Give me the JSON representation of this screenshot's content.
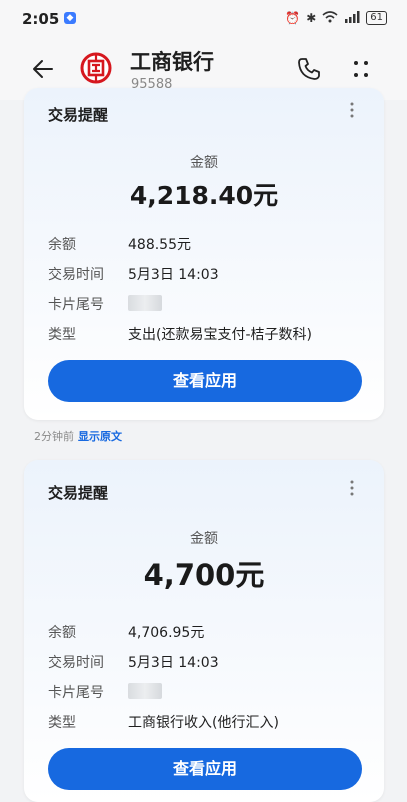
{
  "status_bar": {
    "time": "2:05",
    "battery": "61"
  },
  "header": {
    "bank_name": "工商银行",
    "bank_number": "95588"
  },
  "messages": [
    {
      "title": "交易提醒",
      "amount_label": "金额",
      "amount": "4,218.40元",
      "rows": [
        {
          "label": "余额",
          "value": "488.55元"
        },
        {
          "label": "交易时间",
          "value": "5月3日 14:03"
        },
        {
          "label": "卡片尾号",
          "value": ""
        },
        {
          "label": "类型",
          "value": "支出(还款易宝支付-桔子数科)"
        }
      ],
      "action_label": "查看应用",
      "timestamp": "2分钟前",
      "show_original": "显示原文"
    },
    {
      "title": "交易提醒",
      "amount_label": "金额",
      "amount": "4,700元",
      "rows": [
        {
          "label": "余额",
          "value": "4,706.95元"
        },
        {
          "label": "交易时间",
          "value": "5月3日 14:03"
        },
        {
          "label": "卡片尾号",
          "value": ""
        },
        {
          "label": "类型",
          "value": "工商银行收入(他行汇入)"
        }
      ],
      "action_label": "查看应用"
    }
  ],
  "colors": {
    "accent": "#1769e0",
    "logo_red": "#d6171e"
  }
}
